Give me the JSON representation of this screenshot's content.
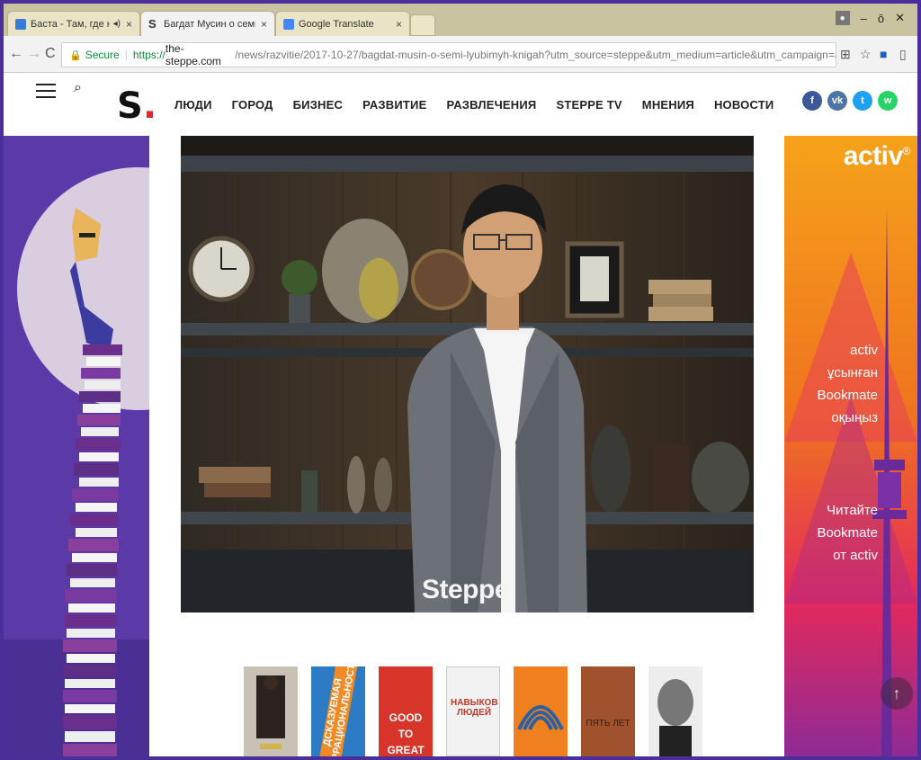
{
  "browser": {
    "tabs": [
      {
        "title": "Баста - Там, где нас",
        "icon": "audio-icon",
        "close": "×"
      },
      {
        "title": "Багдат Мусин о семи л",
        "close": "×"
      },
      {
        "title": "Google Translate",
        "close": "×"
      }
    ],
    "window_controls": [
      "–",
      "ō",
      "✕"
    ],
    "address": {
      "secure_label": "Secure",
      "url_protocol": "https://",
      "url_host": "the-steppe.com",
      "url_path": "/news/razvitie/2017-10-27/bagdat-musin-o-semi-lyubimyh-knigah?utm_source=steppe&utm_medium=article&utm_campaign=activ_PR"
    }
  },
  "site": {
    "logo_letter": "S",
    "logo_dot": ".",
    "nav": [
      "ЛЮДИ",
      "ГОРОД",
      "БИЗНЕС",
      "РАЗВИТИЕ",
      "РАЗВЛЕЧЕНИЯ",
      "STEPPE TV",
      "МНЕНИЯ",
      "НОВОСТИ"
    ],
    "social": [
      {
        "name": "facebook-icon",
        "glyph": "f",
        "color": "#3b5998"
      },
      {
        "name": "vk-icon",
        "glyph": "vk",
        "color": "#4c75a3"
      },
      {
        "name": "twitter-icon",
        "glyph": "t",
        "color": "#1da1f2"
      },
      {
        "name": "whatsapp-icon",
        "glyph": "w",
        "color": "#25d366"
      }
    ]
  },
  "hero": {
    "watermark": "Steppe"
  },
  "right_banner": {
    "brand": "activ",
    "brand_mark": "®",
    "kz_lines": [
      "activ",
      "ұсынған",
      "Bookmate",
      "оқыңыз"
    ],
    "ru_lines": [
      "Читайте",
      "Bookmate",
      "от activ"
    ]
  },
  "book_covers": [
    {
      "color": "#c8c2b6",
      "text": ""
    },
    {
      "color": "#2d7bc4",
      "text": "ДСКАЗУЕМАЯ ИРРАЦИОНАЛЬНОСТЬ"
    },
    {
      "color": "#d8352a",
      "text": "GOOD TO GREAT"
    },
    {
      "color": "#f2f2f2",
      "text": "НАВЫКОВ ЛЮДЕЙ"
    },
    {
      "color": "#f07f1e",
      "text": ""
    },
    {
      "color": "#a0522d",
      "text": "ПЯТЬ ЛЕТ"
    },
    {
      "color": "#ededed",
      "text": ""
    }
  ]
}
